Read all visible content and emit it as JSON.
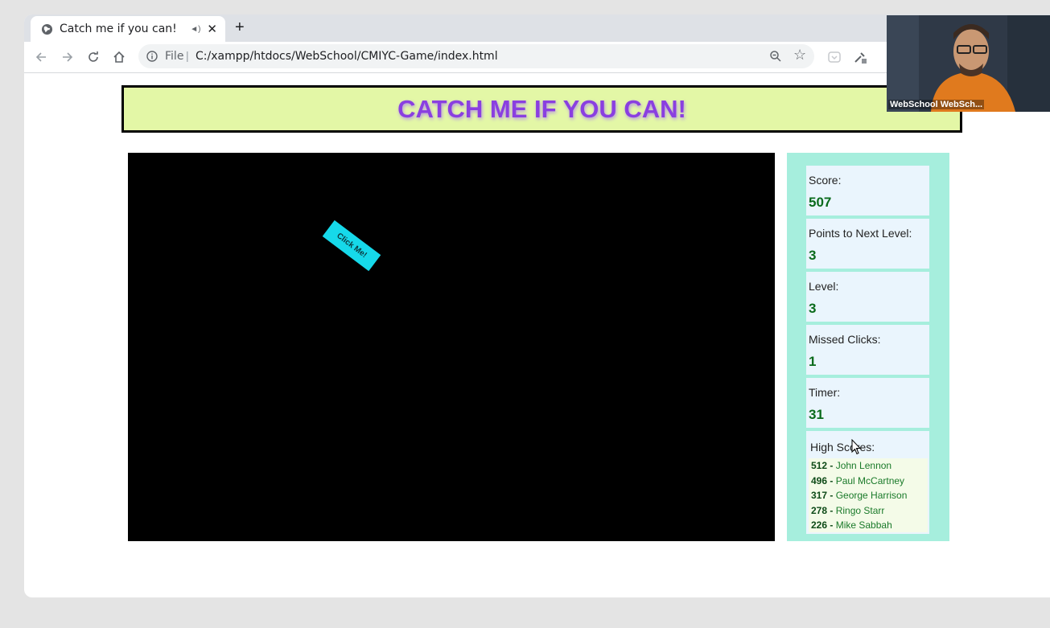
{
  "browser": {
    "tab_title": "Catch me if you can!",
    "new_tab_label": "+",
    "scheme_label": "File",
    "url": "C:/xampp/htdocs/WebSchool/CMIYC-Game/index.html"
  },
  "page": {
    "heading": "CATCH ME IF YOU CAN!",
    "target_label": "Click Me!"
  },
  "stats": [
    {
      "label": "Score:",
      "value": "507"
    },
    {
      "label": "Points to Next Level:",
      "value": "3"
    },
    {
      "label": "Level:",
      "value": "3"
    },
    {
      "label": "Missed Clicks:",
      "value": "1"
    },
    {
      "label": "Timer:",
      "value": "31"
    }
  ],
  "high_scores": {
    "label": "High Scores:",
    "entries": [
      {
        "score": "512 -",
        "name": " John Lennon"
      },
      {
        "score": "496 -",
        "name": " Paul McCartney"
      },
      {
        "score": "317 -",
        "name": " George Harrison"
      },
      {
        "score": "278 -",
        "name": " Ringo Starr"
      },
      {
        "score": "226 -",
        "name": " Mike Sabbah"
      }
    ]
  },
  "webcam": {
    "name": "WebSchool WebSch..."
  },
  "colors": {
    "banner_bg": "#e3f7a6",
    "heading": "#8a3fe0",
    "panel_bg": "#a6eedd",
    "target": "#16d9ea",
    "stat_value": "#0b6b1c"
  }
}
